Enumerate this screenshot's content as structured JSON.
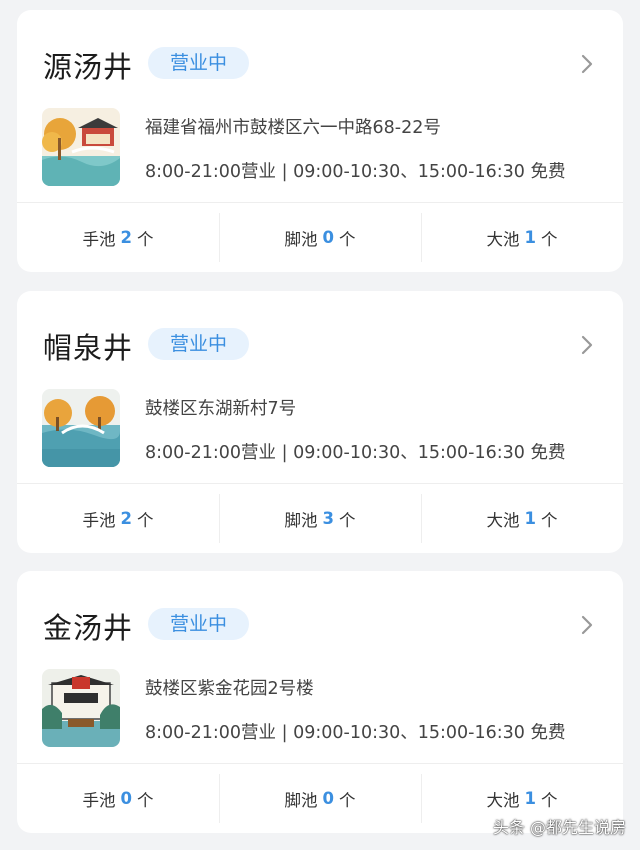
{
  "colors": {
    "accent": "#3b8fe0",
    "badge_bg": "#e7f2fd",
    "background": "#f2f3f5"
  },
  "cards": [
    {
      "name": "源汤井",
      "status": "营业中",
      "address": "福建省福州市鼓楼区六一中路68-22号",
      "hours": "8:00-21:00营业 | 09:00-10:30、15:00-16:30 免费",
      "stats": [
        {
          "label": "手池",
          "count": "2",
          "unit": "个"
        },
        {
          "label": "脚池",
          "count": "0",
          "unit": "个"
        },
        {
          "label": "大池",
          "count": "1",
          "unit": "个"
        }
      ]
    },
    {
      "name": "帽泉井",
      "status": "营业中",
      "address": "鼓楼区东湖新村7号",
      "hours": "8:00-21:00营业 | 09:00-10:30、15:00-16:30 免费",
      "stats": [
        {
          "label": "手池",
          "count": "2",
          "unit": "个"
        },
        {
          "label": "脚池",
          "count": "3",
          "unit": "个"
        },
        {
          "label": "大池",
          "count": "1",
          "unit": "个"
        }
      ]
    },
    {
      "name": "金汤井",
      "status": "营业中",
      "address": "鼓楼区紫金花园2号楼",
      "hours": "8:00-21:00营业 | 09:00-10:30、15:00-16:30 免费",
      "stats": [
        {
          "label": "手池",
          "count": "0",
          "unit": "个"
        },
        {
          "label": "脚池",
          "count": "0",
          "unit": "个"
        },
        {
          "label": "大池",
          "count": "1",
          "unit": "个"
        }
      ]
    }
  ],
  "watermark": "头条 @都先生说房"
}
